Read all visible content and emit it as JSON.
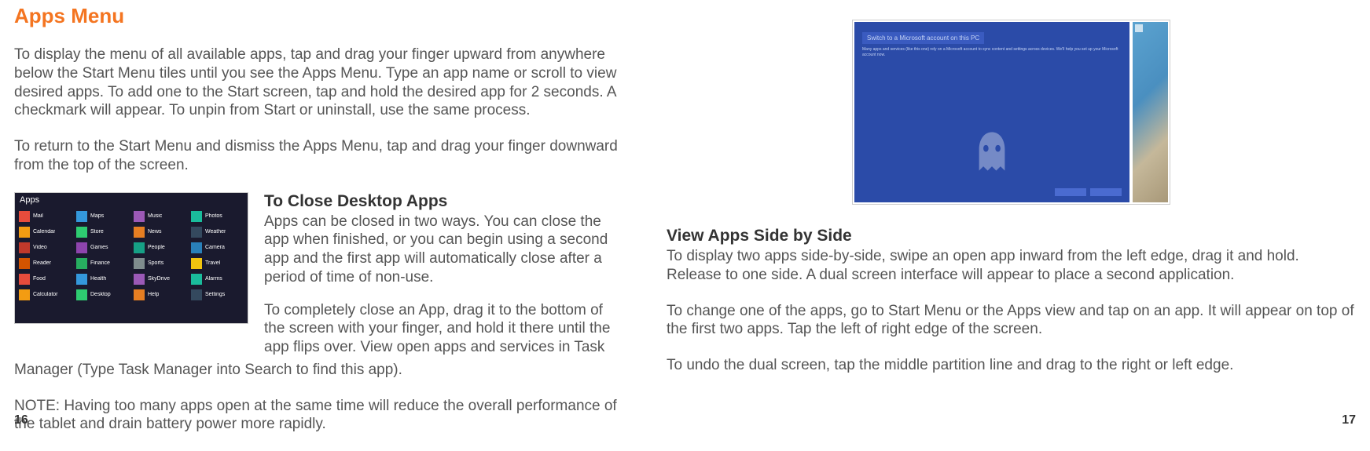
{
  "left": {
    "title": "Apps Menu",
    "para1": "To display the menu of all available apps, tap and drag your finger upward from anywhere below the Start Menu tiles until you see the Apps Menu. Type an app name or scroll to view desired apps. To add one to the Start screen, tap and hold the desired app for 2 seconds. A checkmark will appear. To unpin from Start or uninstall, use the same process.",
    "para2": "To return to the Start Menu and dismiss the Apps Menu, tap and drag your finger downward from the top of the screen.",
    "apps_label": "Apps",
    "close_title": "To Close Desktop Apps",
    "close_p1": "Apps can be closed in two ways. You can close the app when finished, or you can begin using a second app and the first app will automatically close after a period of time of non-use.",
    "close_p2": "To completely close an App, drag it to the bottom of the screen with your finger, and hold it there until the app flips over. View open apps and services in Task Manager (Type Task Manager into Search to find this app).",
    "note": "NOTE: Having too many apps open at the same time will reduce the overall performance of the tablet and drain battery power more rapidly."
  },
  "right": {
    "view_title": "View Apps Side by Side",
    "view_p1": "To display two apps side-by-side, swipe an open app inward from the left edge, drag it and hold. Release to one side. A dual screen interface will appear to place a second application.",
    "view_p2": "To change one of the apps, go to Start Menu or the Apps view and tap on an app. It will appear on top of the first two apps. Tap the left of right edge of the screen.",
    "view_p3": "To undo the dual screen, tap the middle partition line and drag to the right or left edge.",
    "blue_header": "Switch to a Microsoft account on this PC"
  },
  "page_left": "16",
  "page_right": "17",
  "app_tiles": [
    {
      "color": "#e74c3c",
      "label": "Mail"
    },
    {
      "color": "#3498db",
      "label": "Maps"
    },
    {
      "color": "#9b59b6",
      "label": "Music"
    },
    {
      "color": "#1abc9c",
      "label": "Photos"
    },
    {
      "color": "#f39c12",
      "label": "Calendar"
    },
    {
      "color": "#2ecc71",
      "label": "Store"
    },
    {
      "color": "#e67e22",
      "label": "News"
    },
    {
      "color": "#34495e",
      "label": "Weather"
    },
    {
      "color": "#c0392b",
      "label": "Video"
    },
    {
      "color": "#8e44ad",
      "label": "Games"
    },
    {
      "color": "#16a085",
      "label": "People"
    },
    {
      "color": "#2980b9",
      "label": "Camera"
    },
    {
      "color": "#d35400",
      "label": "Reader"
    },
    {
      "color": "#27ae60",
      "label": "Finance"
    },
    {
      "color": "#7f8c8d",
      "label": "Sports"
    },
    {
      "color": "#f1c40f",
      "label": "Travel"
    },
    {
      "color": "#e74c3c",
      "label": "Food"
    },
    {
      "color": "#3498db",
      "label": "Health"
    },
    {
      "color": "#9b59b6",
      "label": "SkyDrive"
    },
    {
      "color": "#1abc9c",
      "label": "Alarms"
    },
    {
      "color": "#f39c12",
      "label": "Calculator"
    },
    {
      "color": "#2ecc71",
      "label": "Desktop"
    },
    {
      "color": "#e67e22",
      "label": "Help"
    },
    {
      "color": "#34495e",
      "label": "Settings"
    }
  ]
}
